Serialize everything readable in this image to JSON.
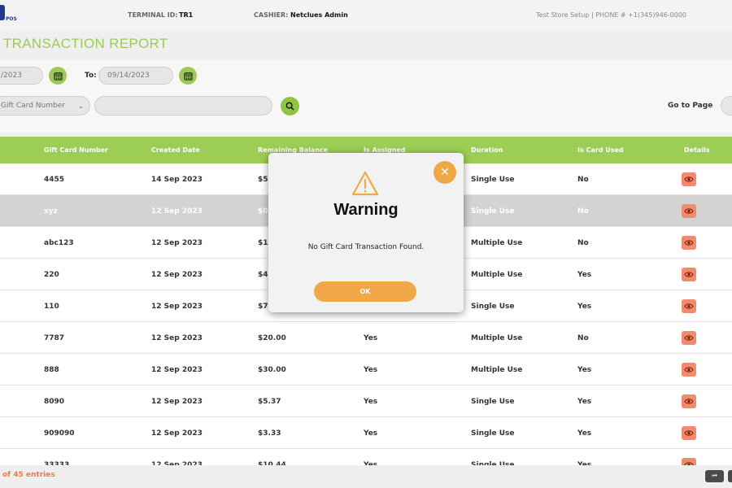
{
  "header": {
    "logo_text": "POS",
    "terminal_label": "TERMINAL ID:",
    "terminal_value": "TR1",
    "cashier_label": "CASHIER:",
    "cashier_value": "Netclues Admin",
    "store_info": "Test Store Setup | PHONE # +1(345)946-0000"
  },
  "page": {
    "title": "TRANSACTION REPORT"
  },
  "filters": {
    "from_date": "/2023",
    "to_label": "To:",
    "to_date": "09/14/2023",
    "search_by": "Gift Card Number",
    "search_value": "",
    "goto_label": "Go to Page",
    "goto_value": ""
  },
  "table": {
    "columns": [
      "Gift Card Number",
      "Created Date",
      "Remaining Balance",
      "Is Assigned",
      "Duration",
      "Is Card Used",
      "Details"
    ],
    "rows": [
      {
        "card": "4455",
        "created": "14 Sep 2023",
        "balance": "$50",
        "assigned": "",
        "duration": "Single Use",
        "used": "No"
      },
      {
        "card": "xyz",
        "created": "12 Sep 2023",
        "balance": "$0.",
        "assigned": "",
        "duration": "Single Use",
        "used": "No"
      },
      {
        "card": "abc123",
        "created": "12 Sep 2023",
        "balance": "$10",
        "assigned": "",
        "duration": "Multiple Use",
        "used": "No"
      },
      {
        "card": "220",
        "created": "12 Sep 2023",
        "balance": "$4.",
        "assigned": "",
        "duration": "Multiple Use",
        "used": "Yes"
      },
      {
        "card": "110",
        "created": "12 Sep 2023",
        "balance": "$7.",
        "assigned": "",
        "duration": "Single Use",
        "used": "Yes"
      },
      {
        "card": "7787",
        "created": "12 Sep 2023",
        "balance": "$20.00",
        "assigned": "Yes",
        "duration": "Multiple Use",
        "used": "No"
      },
      {
        "card": "888",
        "created": "12 Sep 2023",
        "balance": "$30.00",
        "assigned": "Yes",
        "duration": "Multiple Use",
        "used": "Yes"
      },
      {
        "card": "8090",
        "created": "12 Sep 2023",
        "balance": "$5.37",
        "assigned": "Yes",
        "duration": "Single Use",
        "used": "Yes"
      },
      {
        "card": "909090",
        "created": "12 Sep 2023",
        "balance": "$3.33",
        "assigned": "Yes",
        "duration": "Single Use",
        "used": "Yes"
      },
      {
        "card": "33333",
        "created": "12 Sep 2023",
        "balance": "$10.44",
        "assigned": "Yes",
        "duration": "Single Use",
        "used": "Yes"
      }
    ]
  },
  "footer": {
    "entries_text": "of 45 entries",
    "first_page_glyph": "⏮"
  },
  "modal": {
    "title": "Warning",
    "message": "No Gift Card Transaction Found.",
    "ok_label": "OK",
    "close_glyph": "✕"
  },
  "icons": {
    "warning": "warning-icon",
    "calendar": "calendar-icon",
    "search": "search-icon",
    "eye": "eye-icon",
    "close": "close-icon"
  },
  "colors": {
    "accent_green": "#9cce55",
    "accent_orange": "#f0a847",
    "detail_button": "#f28b6e",
    "entries_text": "#f07a4a"
  }
}
